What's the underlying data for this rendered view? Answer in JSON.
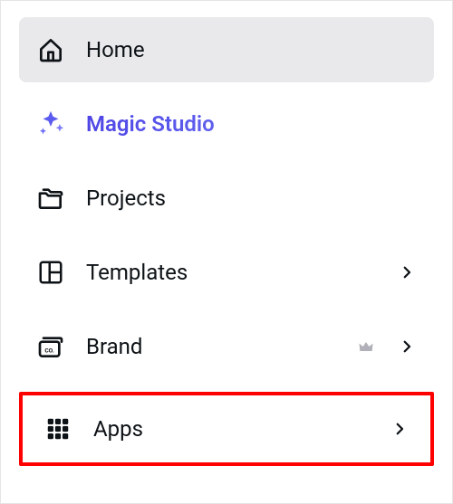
{
  "sidebar": {
    "items": [
      {
        "key": "home",
        "label": "Home",
        "active": true,
        "has_chevron": false,
        "icon": "home-icon"
      },
      {
        "key": "magic-studio",
        "label": "Magic Studio",
        "active": false,
        "has_chevron": false,
        "icon": "sparkle-icon"
      },
      {
        "key": "projects",
        "label": "Projects",
        "active": false,
        "has_chevron": false,
        "icon": "folders-icon"
      },
      {
        "key": "templates",
        "label": "Templates",
        "active": false,
        "has_chevron": true,
        "icon": "templates-icon"
      },
      {
        "key": "brand",
        "label": "Brand",
        "active": false,
        "has_chevron": true,
        "icon": "brand-icon",
        "has_crown": true
      },
      {
        "key": "apps",
        "label": "Apps",
        "active": false,
        "has_chevron": true,
        "icon": "apps-grid-icon",
        "highlighted": true
      }
    ]
  }
}
